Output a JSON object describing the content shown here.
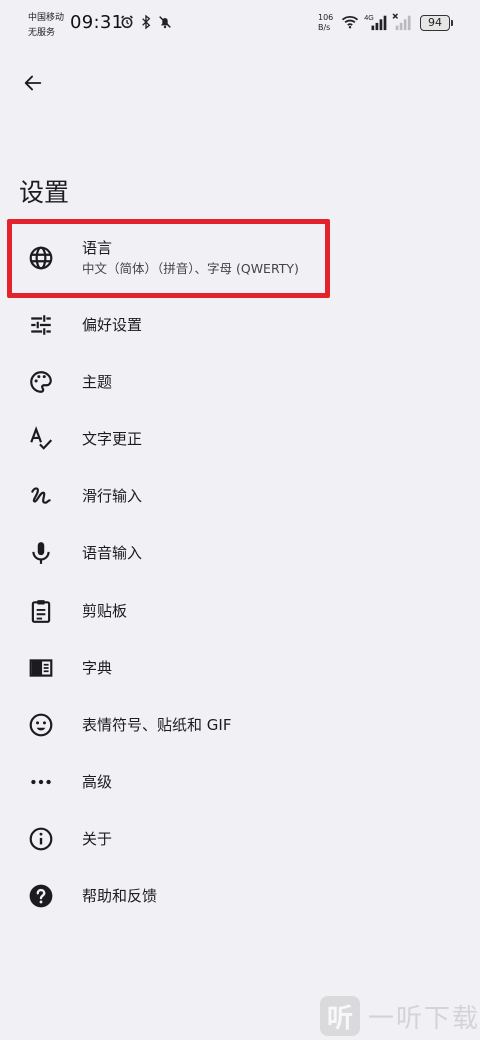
{
  "status_bar": {
    "carrier_line1": "中国移动",
    "carrier_line2": "无服务",
    "time": "09:31",
    "net_speed_value": "106",
    "net_speed_unit": "B/s",
    "network_type": "4G",
    "battery": "94"
  },
  "header": {
    "title": "设置"
  },
  "settings": {
    "items": [
      {
        "label": "语言",
        "sublabel": "中文（简体）（拼音）、字母 (QWERTY)",
        "icon": "globe-icon"
      },
      {
        "label": "偏好设置",
        "icon": "sliders-icon"
      },
      {
        "label": "主题",
        "icon": "palette-icon"
      },
      {
        "label": "文字更正",
        "icon": "spellcheck-icon"
      },
      {
        "label": "滑行输入",
        "icon": "gesture-icon"
      },
      {
        "label": "语音输入",
        "icon": "microphone-icon"
      },
      {
        "label": "剪贴板",
        "icon": "clipboard-icon"
      },
      {
        "label": "字典",
        "icon": "dictionary-icon"
      },
      {
        "label": "表情符号、贴纸和 GIF",
        "icon": "emoji-icon"
      },
      {
        "label": "高级",
        "icon": "more-icon"
      },
      {
        "label": "关于",
        "icon": "info-icon"
      },
      {
        "label": "帮助和反馈",
        "icon": "help-icon"
      }
    ]
  },
  "highlight": {
    "color": "#e3232b",
    "target": "语言"
  },
  "watermark": {
    "logo_char": "听",
    "text": "一听下载"
  }
}
